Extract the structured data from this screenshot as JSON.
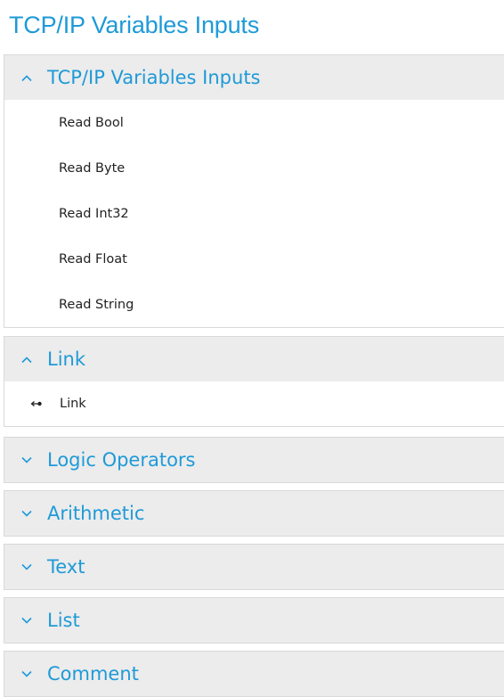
{
  "page": {
    "title": "TCP/IP Variables Inputs"
  },
  "panels": [
    {
      "title": "TCP/IP Variables Inputs",
      "expanded": true,
      "chevron_icon": "chevron-up-icon",
      "items": [
        {
          "label": "Read Bool"
        },
        {
          "label": "Read Byte"
        },
        {
          "label": "Read Int32"
        },
        {
          "label": "Read Float"
        },
        {
          "label": "Read String"
        }
      ]
    },
    {
      "title": "Link",
      "expanded": true,
      "chevron_icon": "chevron-up-icon",
      "items": [
        {
          "label": "Link",
          "icon": "link-arrow-icon"
        }
      ]
    },
    {
      "title": "Logic Operators",
      "expanded": false,
      "chevron_icon": "chevron-down-icon"
    },
    {
      "title": "Arithmetic",
      "expanded": false,
      "chevron_icon": "chevron-down-icon"
    },
    {
      "title": "Text",
      "expanded": false,
      "chevron_icon": "chevron-down-icon"
    },
    {
      "title": "List",
      "expanded": false,
      "chevron_icon": "chevron-down-icon"
    },
    {
      "title": "Comment",
      "expanded": false,
      "chevron_icon": "chevron-down-icon"
    }
  ],
  "colors": {
    "accent": "#1e9ad8",
    "header_background": "#ececec",
    "border": "#d9d9d9",
    "item_text": "#222222"
  }
}
